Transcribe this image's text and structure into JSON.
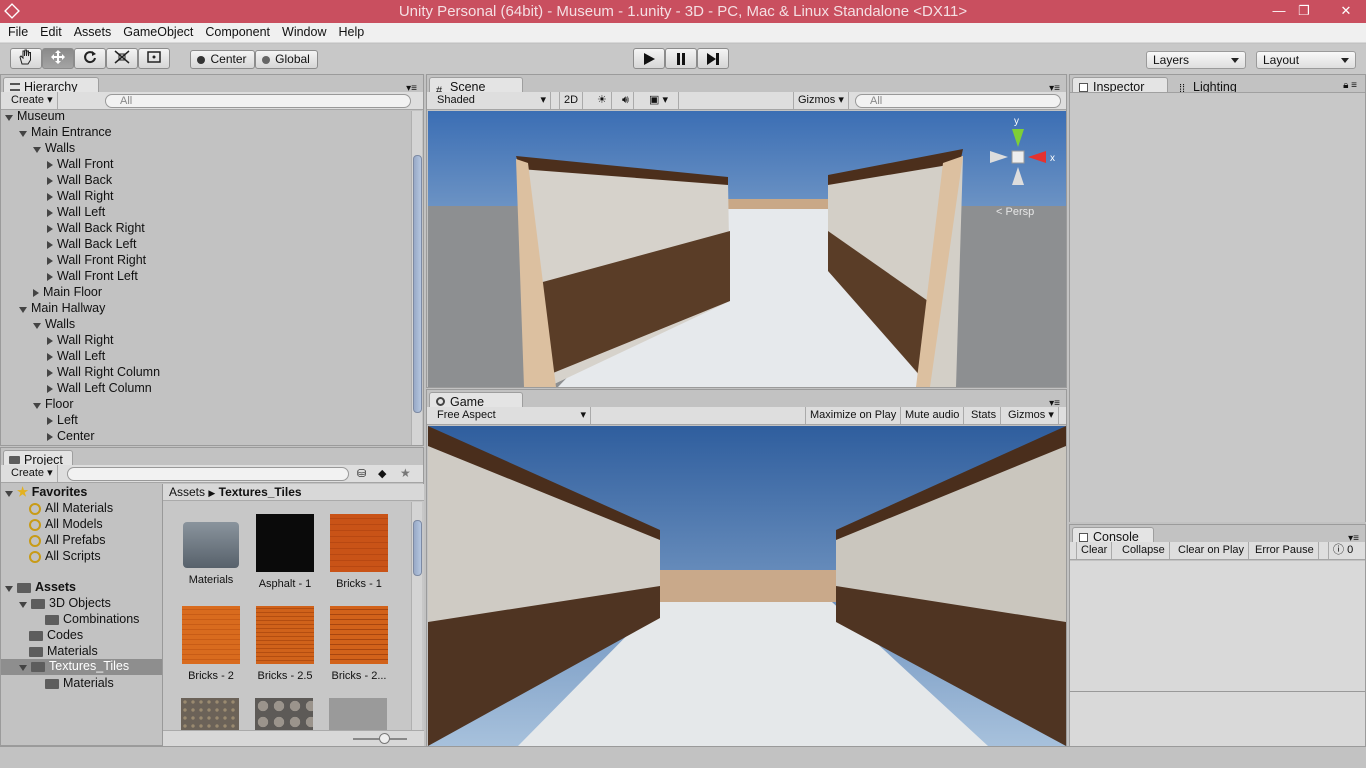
{
  "window": {
    "title": "Unity Personal (64bit) - Museum - 1.unity - 3D - PC, Mac & Linux Standalone <DX11>",
    "minimize": "—",
    "restore": "❐",
    "close": "✕"
  },
  "menu": [
    "File",
    "Edit",
    "Assets",
    "GameObject",
    "Component",
    "Window",
    "Help"
  ],
  "toolbar": {
    "pivot": "Center",
    "space": "Global",
    "layers": "Layers",
    "layout": "Layout"
  },
  "hierarchy": {
    "tab": "Hierarchy",
    "create": "Create",
    "search_placeholder": "All",
    "items": [
      "Museum",
      "Main Entrance",
      "Walls",
      "Wall Front",
      "Wall Back",
      "Wall Right",
      "Wall Left",
      "Wall Back Right",
      "Wall Back Left",
      "Wall Front Right",
      "Wall Front Left",
      "Main Floor",
      "Main Hallway",
      "Walls",
      "Wall Right",
      "Wall Left",
      "Wall Right Column",
      "Wall Left Column",
      "Floor",
      "Left",
      "Center"
    ]
  },
  "scene": {
    "tab": "Scene",
    "shading": "Shaded",
    "mode2d": "2D",
    "gizmos": "Gizmos",
    "search_placeholder": "All",
    "persp": "Persp",
    "axis_y": "y",
    "axis_x": "x"
  },
  "game": {
    "tab": "Game",
    "aspect": "Free Aspect",
    "maximize": "Maximize on Play",
    "mute": "Mute audio",
    "stats": "Stats",
    "gizmos": "Gizmos"
  },
  "inspector": {
    "tab": "Inspector",
    "lighting_tab": "Lighting"
  },
  "console": {
    "tab": "Console",
    "clear": "Clear",
    "collapse": "Collapse",
    "clear_on_play": "Clear on Play",
    "error_pause": "Error Pause",
    "error_count": "0"
  },
  "project": {
    "tab": "Project",
    "create": "Create",
    "favorites_label": "Favorites",
    "favorites": [
      "All Materials",
      "All Models",
      "All Prefabs",
      "All Scripts"
    ],
    "assets_label": "Assets",
    "folders": [
      "3D Objects",
      "Combinations",
      "Codes",
      "Materials",
      "Textures_Tiles",
      "Materials"
    ],
    "breadcrumb_root": "Assets",
    "breadcrumb_current": "Textures_Tiles",
    "assets": [
      "Materials",
      "Asphalt - 1",
      "Bricks - 1",
      "Bricks - 2",
      "Bricks - 2.5",
      "Bricks - 2..."
    ]
  }
}
